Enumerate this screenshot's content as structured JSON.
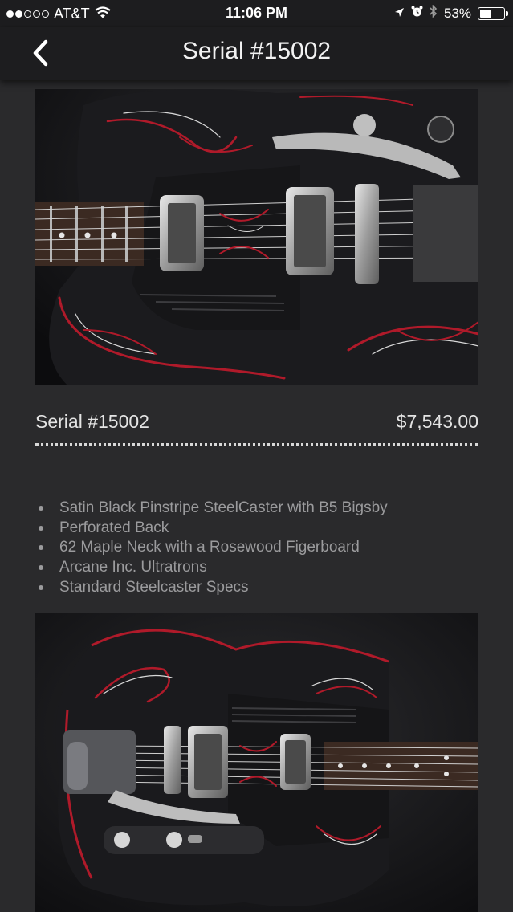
{
  "status_bar": {
    "carrier": "AT&T",
    "time": "11:06 PM",
    "battery_percent": "53%",
    "battery_level": 0.53,
    "signal_bars_filled": 2,
    "signal_bars_total": 5,
    "icons": [
      "wifi-icon",
      "location-arrow-icon",
      "alarm-icon",
      "bluetooth-icon",
      "battery-icon"
    ]
  },
  "nav": {
    "title": "Serial #15002",
    "back_icon": "chevron-left-icon"
  },
  "product": {
    "name": "Serial #15002",
    "price": "$7,543.00"
  },
  "specs": [
    "Satin Black Pinstripe SteelCaster with B5 Bigsby",
    "Perforated Back",
    "62 Maple Neck with a Rosewood Figerboard",
    "Arcane Inc. Ultratrons",
    "Standard Steelcaster Specs"
  ],
  "photos": {
    "top": "guitar-closeup-photo",
    "bottom": "guitar-full-body-photo"
  },
  "colors": {
    "background": "#2a2a2c",
    "bar": "#1d1d1f",
    "pinstripe_red": "#b01a2a",
    "spec_text": "#9b9b9d"
  }
}
